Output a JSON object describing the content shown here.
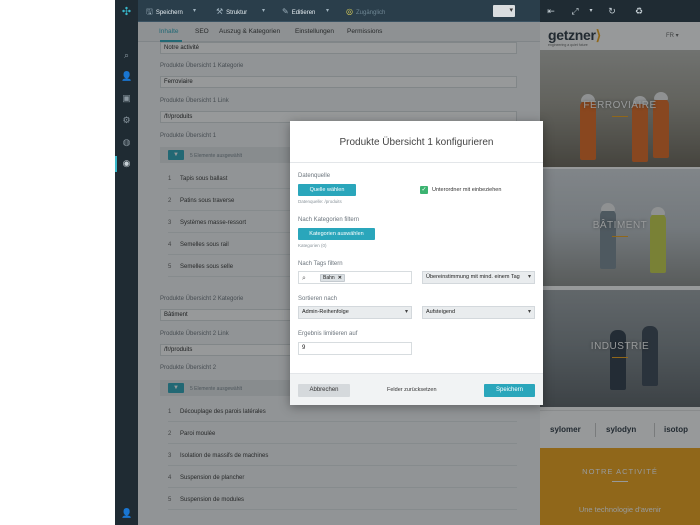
{
  "toolbar": {
    "save_label": "Speichern",
    "structure_label": "Struktur",
    "editor_label": "Editieren",
    "status_label": "Zugänglich"
  },
  "tabs": [
    {
      "label": "Inhalte"
    },
    {
      "label": "SEO"
    },
    {
      "label": "Auszug & Kategorien"
    },
    {
      "label": "Einstellungen"
    },
    {
      "label": "Permissions"
    }
  ],
  "editor": {
    "top_value": "Notre activité",
    "section1": {
      "kategorie_label": "Produkte Übersicht 1 Kategorie",
      "kategorie_value": "Ferroviaire",
      "link_label": "Produkte Übersicht 1 Link",
      "link_value": "/fr/produits",
      "list_label": "Produkte Übersicht 1",
      "list_count": "5 Elemente ausgewählt",
      "items": [
        {
          "num": "1",
          "label": "Tapis sous ballast"
        },
        {
          "num": "2",
          "label": "Patins sous traverse"
        },
        {
          "num": "3",
          "label": "Systèmes masse-ressort"
        },
        {
          "num": "4",
          "label": "Semelles sous rail"
        },
        {
          "num": "5",
          "label": "Semelles sous selle"
        }
      ]
    },
    "section2": {
      "kategorie_label": "Produkte Übersicht 2 Kategorie",
      "kategorie_value": "Bâtiment",
      "link_label": "Produkte Übersicht 2 Link",
      "link_value": "/fr/produits",
      "list_label": "Produkte Übersicht 2",
      "list_count": "5 Elemente ausgewählt",
      "items": [
        {
          "num": "1",
          "label": "Découplage des parois latérales"
        },
        {
          "num": "2",
          "label": "Paroi moulée"
        },
        {
          "num": "3",
          "label": "Isolation de massifs de machines"
        },
        {
          "num": "4",
          "label": "Suspension de plancher"
        },
        {
          "num": "5",
          "label": "Suspension de modules"
        }
      ]
    }
  },
  "modal": {
    "title": "Produkte Übersicht 1 konfigurieren",
    "datenquelle_label": "Datenquelle",
    "quelle_button": "Quelle wählen",
    "datenquelle_hint": "Datenquelle: /produits",
    "subordner_label": "Unterordner mit einbeziehen",
    "kategorien_label": "Nach Kategorien filtern",
    "kategorien_button": "Kategorien auswählen",
    "kategorien_hint": "Kategorien (0)",
    "tags_label": "Nach Tags filtern",
    "tag_chip": "Bahn",
    "tags_match": "Übereinstimmung mit mind. einem Tag",
    "sort_label": "Sortieren nach",
    "sort_value": "Admin-Reihenfolge",
    "sort_order": "Aufsteigend",
    "limit_label": "Ergebnis limitieren auf",
    "limit_value": "9",
    "cancel_button": "Abbrechen",
    "reset_button": "Felder zurücksetzen",
    "save_button": "Speichern"
  },
  "preview": {
    "brand_name": "getzner",
    "brand_tagline": "engineering a quiet future",
    "language": "FR",
    "heroes": [
      {
        "title": "FERROVIAIRE"
      },
      {
        "title": "BÂTIMENT"
      },
      {
        "title": "INDUSTRIE"
      }
    ],
    "partners": [
      "sylomer",
      "sylodyn",
      "isotop"
    ],
    "activity_title": "NOTRE ACTIVITÉ",
    "activity_subtitle": "Une technologie d'avenir"
  },
  "colors": {
    "accent": "#2aa6bb",
    "brand_orange": "#f2a516",
    "toolbar": "#2a3e4b",
    "sidebar": "#1f2b33"
  }
}
